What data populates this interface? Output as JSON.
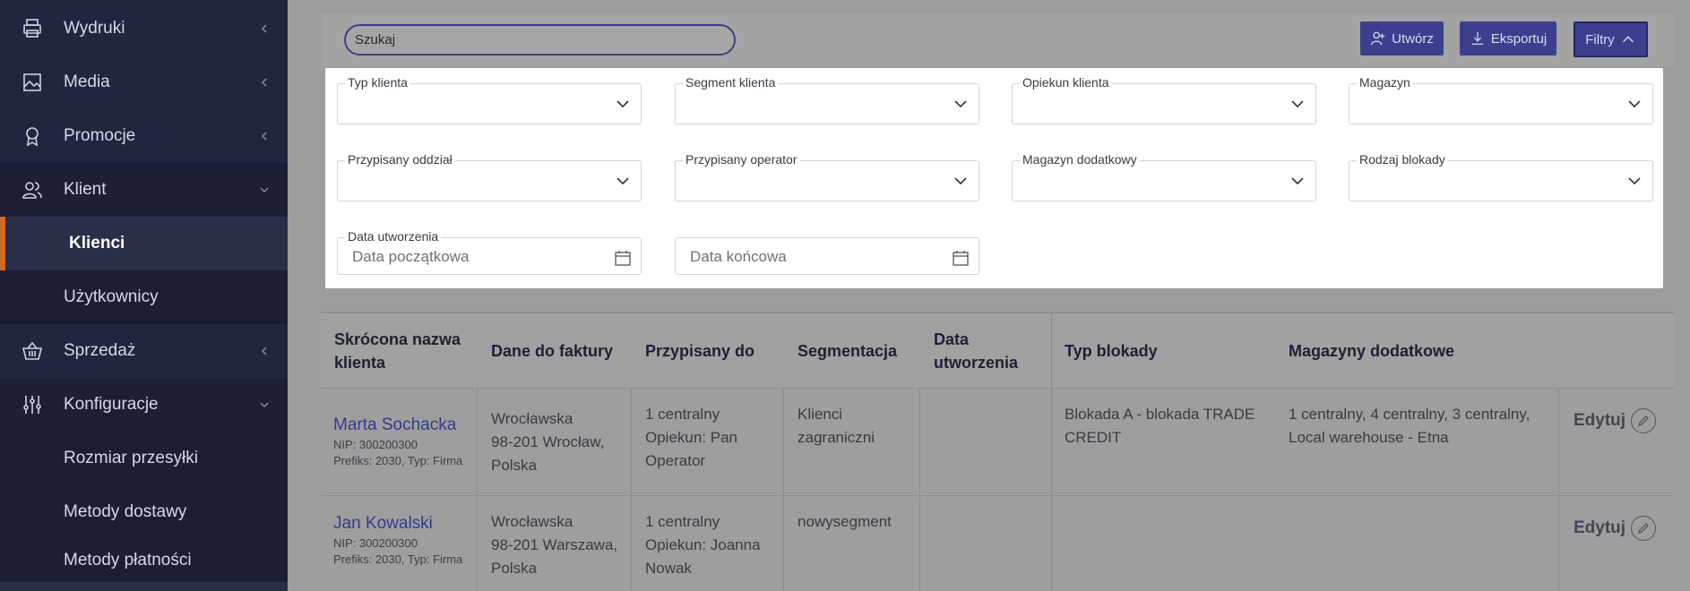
{
  "sidebar": {
    "items": [
      {
        "label": "Wydruki",
        "icon": "printer-icon"
      },
      {
        "label": "Media",
        "icon": "image-icon"
      },
      {
        "label": "Promocje",
        "icon": "award-icon"
      },
      {
        "label": "Klient",
        "icon": "users-icon"
      },
      {
        "label": "Klienci"
      },
      {
        "label": "Użytkownicy"
      },
      {
        "label": "Sprzedaż",
        "icon": "basket-icon"
      },
      {
        "label": "Konfiguracje",
        "icon": "sliders-icon"
      },
      {
        "label": "Rozmiar przesyłki"
      },
      {
        "label": "Metody dostawy"
      },
      {
        "label": "Metody płatności"
      }
    ]
  },
  "toolbar": {
    "search_placeholder": "Szukaj",
    "create_label": "Utwórz",
    "export_label": "Eksportuj",
    "filters_label": "Filtry"
  },
  "filters": {
    "client_type": "Typ klienta",
    "client_segment": "Segment klienta",
    "client_manager": "Opiekun klienta",
    "warehouse": "Magazyn",
    "assigned_branch": "Przypisany oddział",
    "assigned_operator": "Przypisany operator",
    "extra_warehouse": "Magazyn dodatkowy",
    "block_type": "Rodzaj blokady",
    "created_date": "Data utworzenia",
    "start_date_placeholder": "Data początkowa",
    "end_date_placeholder": "Data końcowa"
  },
  "table": {
    "headers": {
      "short_name_1": "Skrócona nazwa",
      "short_name_2": "klienta",
      "invoice": "Dane do faktury",
      "assigned": "Przypisany do",
      "segmentation": "Segmentacja",
      "created_1": "Data",
      "created_2": "utworzenia",
      "block_type": "Typ blokady",
      "extra_warehouses": "Magazyny dodatkowe"
    },
    "rows": [
      {
        "name": "Marta Sochacka",
        "nip": "NIP: 300200300",
        "prefix": "Prefiks: 2030, Typ: Firma",
        "invoice_1": "Wrocławska",
        "invoice_2": "98-201 Wrocław,",
        "invoice_3": "Polska",
        "assigned_1": "1 centralny",
        "assigned_2": "Opiekun: Pan",
        "assigned_3": "Operator",
        "segment_1": "Klienci",
        "segment_2": "zagraniczni",
        "block_1": "Blokada A - blokada TRADE",
        "block_2": "CREDIT",
        "warehouses_1": "1 centralny, 4 centralny, 3 centralny,",
        "warehouses_2": "Local warehouse - Etna",
        "edit": "Edytuj"
      },
      {
        "name": "Jan Kowalski",
        "nip": "NIP: 300200300",
        "prefix": "Prefiks: 2030, Typ: Firma",
        "invoice_1": "Wrocławska",
        "invoice_2": "98-201 Warszawa,",
        "invoice_3": "Polska",
        "assigned_1": "1 centralny",
        "assigned_2": "Opiekun: Joanna",
        "assigned_3": "Nowak",
        "segment_1": "nowysegment",
        "edit": "Edytuj"
      }
    ]
  }
}
